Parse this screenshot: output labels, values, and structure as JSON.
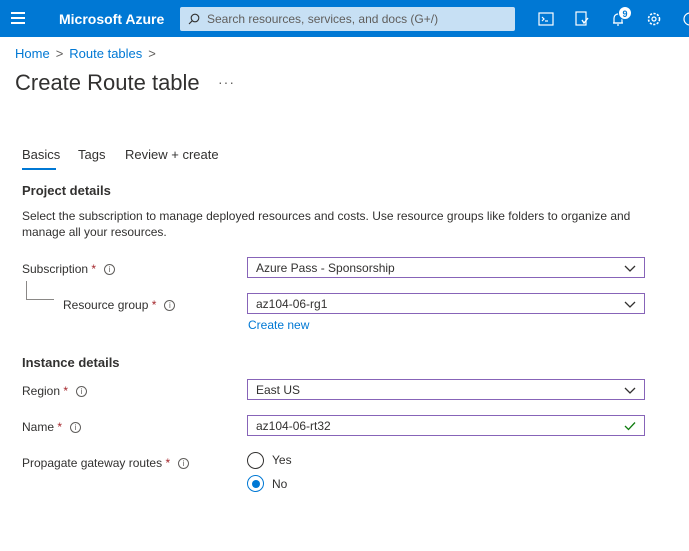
{
  "app": {
    "brand": "Microsoft Azure"
  },
  "search": {
    "placeholder": "Search resources, services, and docs (G+/)"
  },
  "topbar": {
    "notifications_count": "9",
    "icons": [
      "cloud-shell-icon",
      "directory-filter-icon",
      "notifications-icon",
      "settings-icon"
    ]
  },
  "breadcrumb": {
    "home": "Home",
    "route_tables": "Route tables",
    "separator": ">"
  },
  "page": {
    "title": "Create Route table",
    "more": "···"
  },
  "tabs": [
    {
      "label": "Basics",
      "active": true
    },
    {
      "label": "Tags"
    },
    {
      "label": "Review + create"
    }
  ],
  "project": {
    "title": "Project details",
    "description": "Select the subscription to manage deployed resources and costs. Use resource groups like folders to organize and manage all your resources.",
    "subscription_label": "Subscription",
    "subscription_value": "Azure Pass - Sponsorship",
    "resource_group_label": "Resource group",
    "resource_group_value": "az104-06-rg1",
    "create_new": "Create new"
  },
  "instance": {
    "title": "Instance details",
    "region_label": "Region",
    "region_value": "East US",
    "name_label": "Name",
    "name_value": "az104-06-rt32",
    "propagate_label": "Propagate gateway routes",
    "options": [
      {
        "label": "Yes",
        "checked": false
      },
      {
        "label": "No",
        "checked": true
      }
    ]
  },
  "colors": {
    "accent": "#0078d4",
    "field_border": "#8764b8",
    "required": "#a4262c",
    "valid": "#107c10"
  }
}
